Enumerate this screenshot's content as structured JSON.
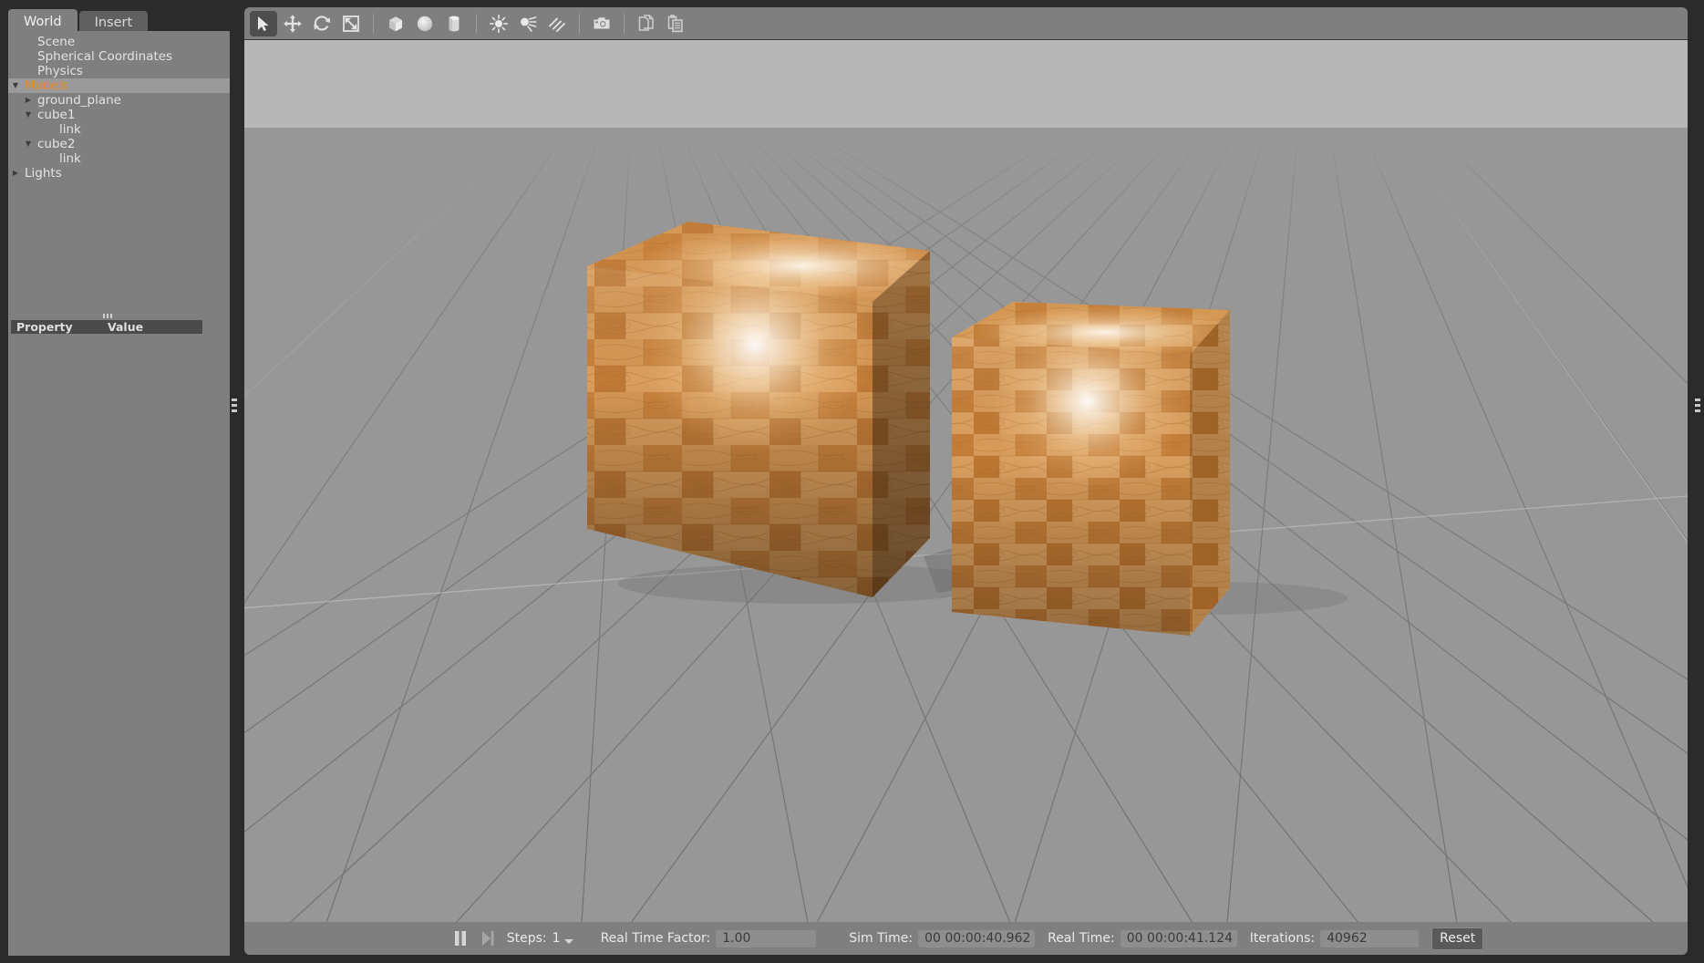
{
  "panel": {
    "tabs": [
      {
        "label": "World",
        "active": true
      },
      {
        "label": "Insert",
        "active": false
      }
    ],
    "tree": [
      {
        "label": "Scene",
        "indent": 1,
        "arrow": "none",
        "selected": false
      },
      {
        "label": "Spherical Coordinates",
        "indent": 1,
        "arrow": "none",
        "selected": false
      },
      {
        "label": "Physics",
        "indent": 1,
        "arrow": "none",
        "selected": false
      },
      {
        "label": "Models",
        "indent": 0,
        "arrow": "down",
        "selected": true
      },
      {
        "label": "ground_plane",
        "indent": 1,
        "arrow": "right",
        "selected": false
      },
      {
        "label": "cube1",
        "indent": 1,
        "arrow": "down",
        "selected": false
      },
      {
        "label": "link",
        "indent": 2,
        "arrow": "none",
        "selected": false
      },
      {
        "label": "cube2",
        "indent": 1,
        "arrow": "down",
        "selected": false
      },
      {
        "label": "link",
        "indent": 2,
        "arrow": "none",
        "selected": false
      },
      {
        "label": "Lights",
        "indent": 0,
        "arrow": "right",
        "selected": false
      }
    ],
    "property_table": {
      "col_property": "Property",
      "col_value": "Value"
    }
  },
  "toolbar": {
    "items": [
      {
        "name": "select-arrow-icon",
        "tooltip": "Selection Mode",
        "active": true
      },
      {
        "name": "translate-icon",
        "tooltip": "Translation Mode",
        "active": false
      },
      {
        "name": "rotate-icon",
        "tooltip": "Rotation Mode",
        "active": false
      },
      {
        "name": "scale-icon",
        "tooltip": "Scale Mode",
        "active": false
      },
      {
        "name": "separator"
      },
      {
        "name": "box-icon",
        "tooltip": "Box",
        "active": false
      },
      {
        "name": "sphere-icon",
        "tooltip": "Sphere",
        "active": false
      },
      {
        "name": "cylinder-icon",
        "tooltip": "Cylinder",
        "active": false
      },
      {
        "name": "separator"
      },
      {
        "name": "point-light-icon",
        "tooltip": "Point Light",
        "active": false
      },
      {
        "name": "spot-light-icon",
        "tooltip": "Spot Light",
        "active": false
      },
      {
        "name": "directional-light-icon",
        "tooltip": "Directional Light",
        "active": false
      },
      {
        "name": "separator"
      },
      {
        "name": "camera-icon",
        "tooltip": "Screenshot",
        "active": false
      },
      {
        "name": "separator"
      },
      {
        "name": "copy-icon",
        "tooltip": "Copy",
        "active": false
      },
      {
        "name": "paste-icon",
        "tooltip": "Paste",
        "active": false
      }
    ]
  },
  "statusbar": {
    "pause_icon": "pause-icon",
    "step_icon": "step-forward-icon",
    "steps_label": "Steps:",
    "steps_value": "1",
    "rtf_label": "Real Time Factor:",
    "rtf_value": "1.00",
    "sim_time_label": "Sim Time:",
    "sim_time_value": "00 00:00:40.962",
    "real_time_label": "Real Time:",
    "real_time_value": "00 00:00:41.124",
    "iterations_label": "Iterations:",
    "iterations_value": "40962",
    "reset_label": "Reset"
  },
  "scene": {
    "sky_color": "#b7b7b7",
    "ground_color": "#979797",
    "grid_color": "#6f6f6f",
    "objects": [
      {
        "name": "cube1",
        "kind": "wooden-box",
        "label": "cube1"
      },
      {
        "name": "cube2",
        "kind": "wooden-box",
        "label": "cube2"
      }
    ],
    "wood_colors": {
      "base": "#cd8a44",
      "light": "#e8b074",
      "dark": "#a8672e",
      "highlight": "#fff4e0"
    }
  }
}
